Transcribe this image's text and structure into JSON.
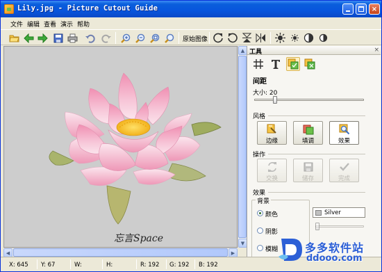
{
  "window": {
    "title": "Lily.jpg - Picture Cutout Guide",
    "controls": {
      "minimize": "minimize",
      "maximize": "maximize",
      "close": "×"
    }
  },
  "menu": [
    "文件",
    "编辑",
    "查看",
    "演示",
    "帮助"
  ],
  "toolbar": {
    "buttons_left": [
      "open-icon",
      "back-arrow-icon",
      "forward-arrow-icon",
      "save-icon",
      "print-icon",
      "undo-icon",
      "redo-icon",
      "zoom-in-icon",
      "zoom-out-icon",
      "zoom-fit-icon",
      "zoom-actual-icon"
    ],
    "original_image_label": "原始图像",
    "buttons_right": [
      "rotate-cw-icon",
      "rotate-ccw-icon",
      "flip-vertical-icon",
      "flip-horizontal-icon",
      "brightness-icon",
      "sun-small-icon",
      "contrast-icon",
      "saturation-icon"
    ]
  },
  "canvas": {
    "caption": "忘言Space",
    "background": "#cdcdcd"
  },
  "panel": {
    "title": "工具",
    "close": "×",
    "tabs": [
      "grid-icon",
      "text-icon",
      "cutout-icon",
      "replace-icon"
    ],
    "spacing": {
      "heading": "间距",
      "size_label": "大小: 20",
      "size_value": 20
    },
    "style": {
      "heading": "风格",
      "buttons": [
        {
          "label": "边缘",
          "icon": "edge-icon",
          "selected": false
        },
        {
          "label": "填调",
          "icon": "fill-icon",
          "selected": false
        },
        {
          "label": "效果",
          "icon": "effect-icon",
          "selected": true
        }
      ]
    },
    "actions": {
      "heading": "操作",
      "buttons": [
        {
          "label": "交换",
          "icon": "swap-icon"
        },
        {
          "label": "储存",
          "icon": "save-icon"
        },
        {
          "label": "完成",
          "icon": "check-icon"
        }
      ]
    },
    "effect": {
      "heading": "效果",
      "background_label": "背景",
      "options": [
        {
          "label": "颜色",
          "selected": true
        },
        {
          "label": "阴影",
          "selected": false
        },
        {
          "label": "模糊",
          "selected": false
        }
      ],
      "color_value": "Silver",
      "color_hex": "#c0c0c0"
    }
  },
  "status": {
    "x": "X: 645",
    "y": "Y: 67",
    "w": "W:",
    "h": "H:",
    "r": "R: 192",
    "g": "G: 192",
    "b": "B: 192"
  },
  "watermark": {
    "site_name": "多多软件站",
    "url": "ddooo.com"
  },
  "colors": {
    "titlebar": "#0855dd",
    "chrome": "#ece9d8",
    "accent": "#2c5fd6"
  }
}
